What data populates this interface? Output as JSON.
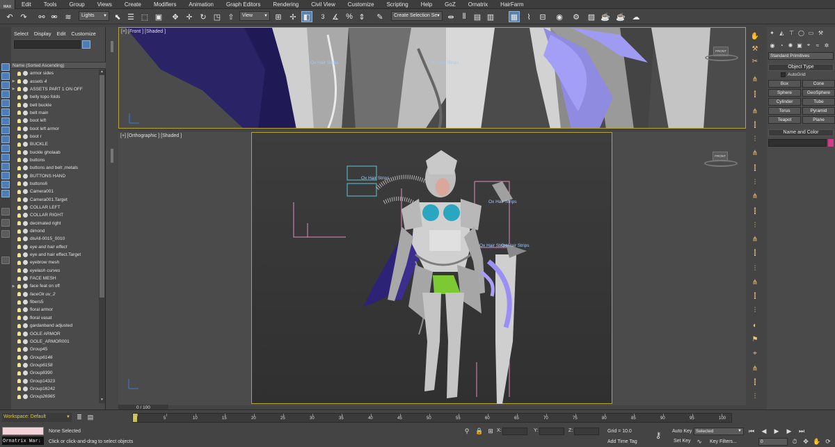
{
  "app_logo": "MAX",
  "menu": [
    "Edit",
    "Tools",
    "Group",
    "Views",
    "Create",
    "Modifiers",
    "Animation",
    "Graph Editors",
    "Rendering",
    "Civil View",
    "Customize",
    "Scripting",
    "Help",
    "GoZ",
    "Ornatrix",
    "HairFarm"
  ],
  "toolbar": {
    "filter_value": "Lights",
    "refcoord_value": "View",
    "snap_number": "3",
    "selection_set_placeholder": "Create Selection Se"
  },
  "explorer": {
    "tabs": [
      "Select",
      "Display",
      "Edit",
      "Customize"
    ],
    "column_header": "Name (Sorted Ascending)",
    "items": [
      {
        "name": "armor sides",
        "italic": false,
        "exp": false,
        "type": "bulb"
      },
      {
        "name": "assets 4",
        "italic": true,
        "exp": true,
        "type": "bulb"
      },
      {
        "name": "ASSETS PART 1 ON OFF",
        "italic": false,
        "exp": true,
        "type": "bulb"
      },
      {
        "name": "belly topo folds",
        "italic": false,
        "exp": false,
        "type": "bulb"
      },
      {
        "name": "belt buckle",
        "italic": false,
        "exp": false,
        "type": "bulb"
      },
      {
        "name": "belt main",
        "italic": false,
        "exp": false,
        "type": "bulb"
      },
      {
        "name": "boot left",
        "italic": false,
        "exp": false,
        "type": "bulb"
      },
      {
        "name": "boot left armor",
        "italic": false,
        "exp": false,
        "type": "bulb"
      },
      {
        "name": "boot r",
        "italic": false,
        "exp": false,
        "type": "bulb"
      },
      {
        "name": "BUCKLE",
        "italic": false,
        "exp": false,
        "type": "bulb"
      },
      {
        "name": "buckle gholaab",
        "italic": false,
        "exp": false,
        "type": "bulb"
      },
      {
        "name": "buttons",
        "italic": false,
        "exp": false,
        "type": "bulb"
      },
      {
        "name": "buttons and belt ,metals",
        "italic": false,
        "exp": false,
        "type": "bulb"
      },
      {
        "name": "BUTTONS HAND",
        "italic": false,
        "exp": false,
        "type": "bulb"
      },
      {
        "name": "buttons6",
        "italic": false,
        "exp": false,
        "type": "bulb"
      },
      {
        "name": "Camera001",
        "italic": false,
        "exp": false,
        "type": "bulb"
      },
      {
        "name": "Camera001.Target",
        "italic": false,
        "exp": false,
        "type": "bulb"
      },
      {
        "name": "COLLAR LEFT",
        "italic": false,
        "exp": false,
        "type": "bulb"
      },
      {
        "name": "COLLAR RIGHT",
        "italic": false,
        "exp": false,
        "type": "bulb"
      },
      {
        "name": "decimated right",
        "italic": false,
        "exp": false,
        "type": "bulb"
      },
      {
        "name": "dimond",
        "italic": false,
        "exp": false,
        "type": "bulb"
      },
      {
        "name": "disAll-0015_0010",
        "italic": false,
        "exp": false,
        "type": "bulb"
      },
      {
        "name": "eye and hair effect",
        "italic": true,
        "exp": false,
        "type": "bulb"
      },
      {
        "name": "eye and hair effect.Target",
        "italic": false,
        "exp": false,
        "type": "bulb"
      },
      {
        "name": "eyebrow mesh",
        "italic": false,
        "exp": false,
        "type": "bulb"
      },
      {
        "name": "eyelash curves",
        "italic": true,
        "exp": false,
        "type": "bulb"
      },
      {
        "name": "FACE MESH",
        "italic": false,
        "exp": false,
        "type": "bulb"
      },
      {
        "name": "face feat on off",
        "italic": false,
        "exp": true,
        "type": "bulb"
      },
      {
        "name": "faceOk uv_2",
        "italic": true,
        "exp": false,
        "type": "bulb"
      },
      {
        "name": "fibers5",
        "italic": false,
        "exp": false,
        "type": "bulb"
      },
      {
        "name": "floral armor",
        "italic": false,
        "exp": false,
        "type": "bulb"
      },
      {
        "name": "floral vasat",
        "italic": false,
        "exp": false,
        "type": "bulb"
      },
      {
        "name": "gardanband adjusted",
        "italic": false,
        "exp": false,
        "type": "bulb"
      },
      {
        "name": "GOLE ARMOR",
        "italic": false,
        "exp": false,
        "type": "bulb"
      },
      {
        "name": "GOLE_ARMOR001",
        "italic": false,
        "exp": false,
        "type": "bulb"
      },
      {
        "name": "Group45",
        "italic": false,
        "exp": false,
        "type": "bulb"
      },
      {
        "name": "Group6146",
        "italic": true,
        "exp": false,
        "type": "bulb"
      },
      {
        "name": "Group6158",
        "italic": true,
        "exp": false,
        "type": "bulb"
      },
      {
        "name": "Group8390",
        "italic": false,
        "exp": false,
        "type": "bulb"
      },
      {
        "name": "Group14323",
        "italic": false,
        "exp": false,
        "type": "bulb"
      },
      {
        "name": "Group16242",
        "italic": false,
        "exp": false,
        "type": "bulb"
      },
      {
        "name": "Group26965",
        "italic": true,
        "exp": false,
        "type": "bulb"
      }
    ]
  },
  "viewports": {
    "front_label": "[+] [Front ] [Shaded ]",
    "ortho_label": "[+] [Orthographic ] [Shaded ]",
    "viewcube_label": "FRONT",
    "hair_label": "Ox Hair Strips"
  },
  "command_panel": {
    "category": "Standard Primitives",
    "object_type_title": "Object Type",
    "autogrid_label": "AutoGrid",
    "primitives": [
      "Box",
      "Cone",
      "Sphere",
      "GeoSphere",
      "Cylinder",
      "Tube",
      "Torus",
      "Pyramid",
      "Teapot",
      "Plane"
    ],
    "name_color_title": "Name and Color",
    "object_color": "#d23a8a"
  },
  "bottom": {
    "workspace": "Workspace: Default",
    "frame_counter": "0 / 100",
    "timeline_ticks": [
      "0",
      "5",
      "10",
      "15",
      "20",
      "25",
      "30",
      "35",
      "40",
      "45",
      "50",
      "55",
      "60",
      "65",
      "70",
      "75",
      "80",
      "85",
      "90",
      "95",
      "100"
    ],
    "selection_status": "None Selected",
    "prompt": "Click or click-and-drag to select objects",
    "ornatrix_prompt": "Ornatrix War:",
    "x_label": "X:",
    "y_label": "Y:",
    "z_label": "Z:",
    "grid": "Grid = 10.0",
    "add_time_tag": "Add Time Tag",
    "auto_key": "Auto Key",
    "set_key": "Set Key",
    "selected_value": "Selected",
    "key_filters": "Key Filters...",
    "frame_value": "0"
  }
}
